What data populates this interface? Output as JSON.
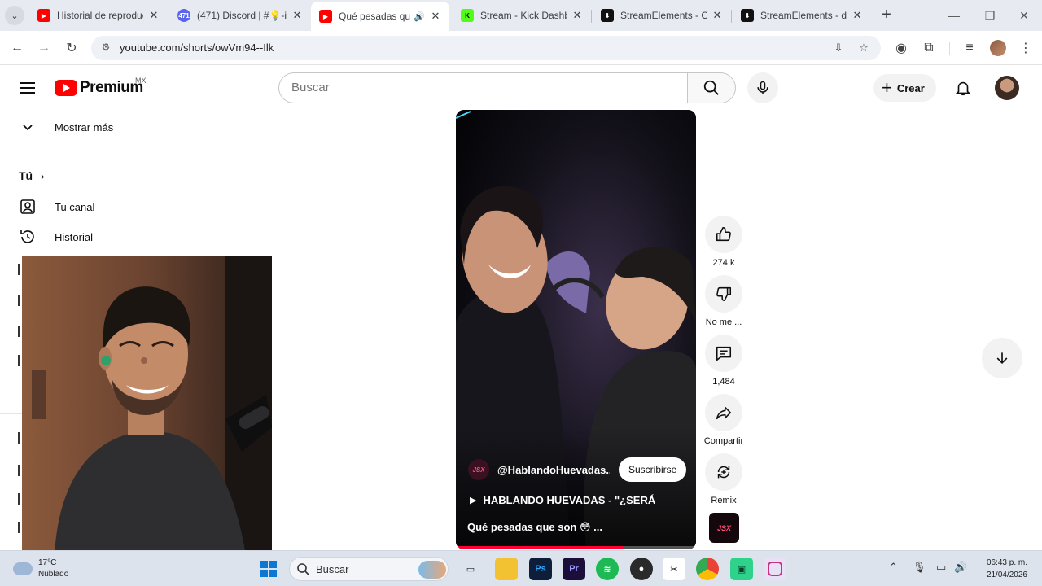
{
  "browser": {
    "tabs": [
      {
        "title": "Historial de reproducc",
        "favicon_color": "#ff0000",
        "active": false
      },
      {
        "title": "(471) Discord | #💡-i",
        "favicon_color": "#5865f2",
        "favicon_text": "471",
        "active": false
      },
      {
        "title": "Qué pesadas que",
        "favicon_color": "#ff0000",
        "active": true
      },
      {
        "title": "Stream - Kick Dashbo",
        "favicon_color": "#53fc18",
        "favicon_text": "K",
        "active": false
      },
      {
        "title": "StreamElements - Ov",
        "favicon_color": "#111111",
        "active": false
      },
      {
        "title": "StreamElements - da",
        "favicon_color": "#111111",
        "active": false
      }
    ],
    "url": "youtube.com/shorts/owVm94--Ilk"
  },
  "youtube": {
    "brand": "Premium",
    "country": "MX",
    "search_placeholder": "Buscar",
    "create_label": "Crear"
  },
  "sidebar": {
    "show_more": "Mostrar más",
    "section_you": "Tú",
    "items": [
      {
        "label": "Tu canal",
        "icon": "channel-icon"
      },
      {
        "label": "Historial",
        "icon": "history-icon"
      }
    ]
  },
  "short": {
    "channel_handle": "@HablandoHuevadas...",
    "channel_avatar_text": "JSX",
    "subscribe_label": "Suscribirse",
    "playlist_title": "HABLANDO HUEVADAS - \"¿SERÁ",
    "caption": "Qué pesadas que son 😳 ...",
    "progress": 0.7
  },
  "actions": {
    "like_count": "274 k",
    "dislike_label": "No me ...",
    "comments_count": "1,484",
    "share_label": "Compartir",
    "remix_label": "Remix"
  },
  "taskbar": {
    "temperature": "17°C",
    "weather": "Nublado",
    "search_label": "Buscar",
    "time": "06:43 p. m.",
    "date": "21/04/2026"
  },
  "colors": {
    "youtube_red": "#ff0000",
    "progress_red": "#ff0033",
    "taskbar": "#dde3ec"
  }
}
